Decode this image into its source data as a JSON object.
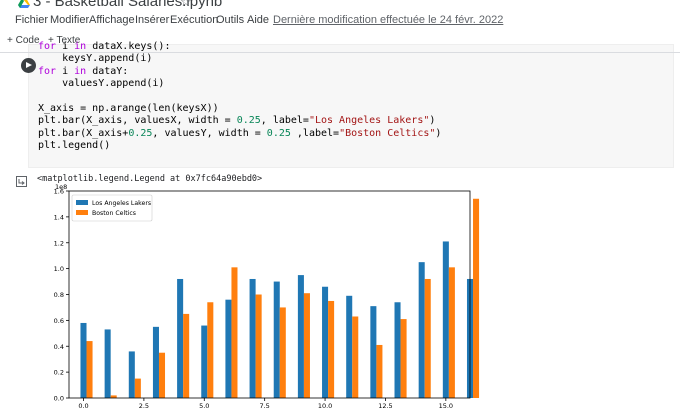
{
  "notebook": {
    "title": "3 - Basketball Salaries.ipynb"
  },
  "menu": {
    "items": [
      "Fichier",
      "Modifier",
      "Affichage",
      "Insérer",
      "Exécution",
      "Outils",
      "Aide"
    ],
    "last_modified": "Dernière modification effectuée le 24 févr. 2022"
  },
  "toolbar": {
    "add_code": "+ Code",
    "add_text": "+ Texte"
  },
  "cell": {
    "code_lines": [
      "for i in dataX.keys():",
      "    keysY.append(i)",
      "for i in dataY:",
      "    valuesY.append(i)",
      "",
      "X_axis = np.arange(len(keysX))",
      "plt.bar(X_axis, valuesX, width = 0.25, label=\"Los Angeles Lakers\")",
      "plt.bar(X_axis+0.25, valuesY, width = 0.25 ,label=\"Boston Celtics\")",
      "plt.legend()"
    ]
  },
  "output": {
    "text": "<matplotlib.legend.Legend at 0x7fc64a90ebd0>"
  },
  "colors": {
    "lakers": "#1f77b4",
    "celtics": "#ff7f0e"
  },
  "chart_data": {
    "type": "bar",
    "offset_label": "1e8",
    "ylim": [
      0,
      1.6
    ],
    "yticks": [
      "0.0",
      "0.2",
      "0.4",
      "0.6",
      "0.8",
      "1.0",
      "1.2",
      "1.4",
      "1.6"
    ],
    "xlim": [
      -0.6,
      16.0
    ],
    "xticks": [
      "0.0",
      "2.5",
      "5.0",
      "7.5",
      "10.0",
      "12.5",
      "15.0"
    ],
    "x": [
      0,
      1,
      2,
      3,
      4,
      5,
      6,
      7,
      8,
      9,
      10,
      11,
      12,
      13,
      14,
      15,
      16
    ],
    "legend_position": "top-left",
    "series": [
      {
        "name": "Los Angeles Lakers",
        "values": [
          0.58,
          0.53,
          0.36,
          0.55,
          0.92,
          0.56,
          0.76,
          0.92,
          0.9,
          0.95,
          0.86,
          0.79,
          0.71,
          0.74,
          1.05,
          1.21,
          0.92
        ]
      },
      {
        "name": "Boston Celtics",
        "values": [
          0.44,
          0.02,
          0.15,
          0.35,
          0.65,
          0.74,
          1.01,
          0.8,
          0.7,
          0.81,
          0.75,
          0.63,
          0.41,
          0.61,
          0.92,
          1.01,
          1.54
        ]
      }
    ]
  }
}
